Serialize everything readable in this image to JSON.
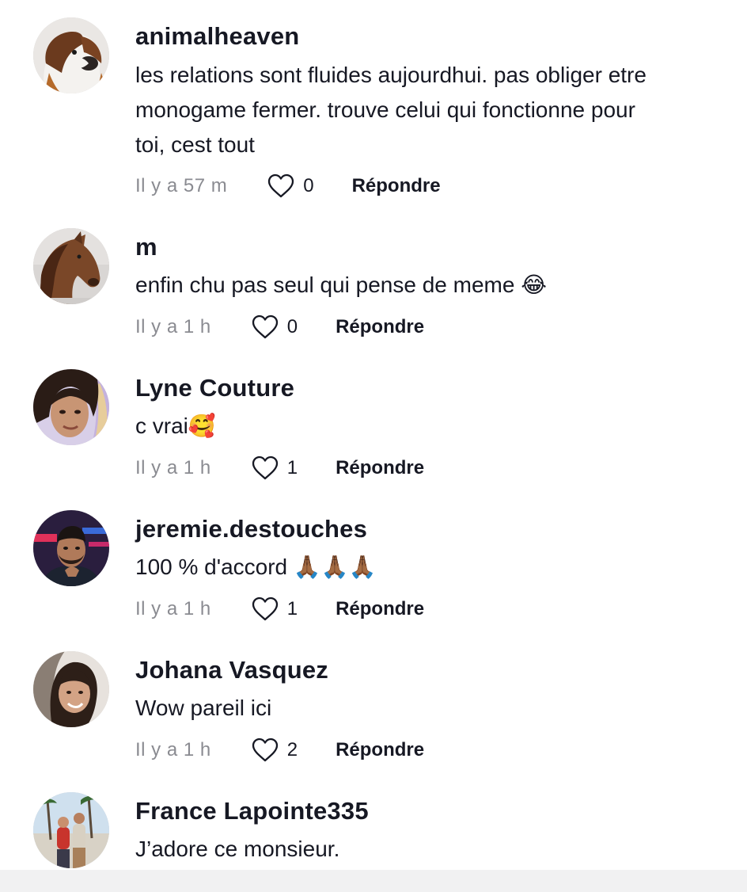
{
  "comments": [
    {
      "username": "animalheaven",
      "lines": [
        "les relations sont fluides aujourdhui. pas obliger etre",
        "monogame fermer. trouve celui qui fonctionne pour",
        "toi, cest tout"
      ],
      "time": "Il y a 57 m",
      "likes": "0",
      "reply": "Répondre",
      "avatar": "dog-photo"
    },
    {
      "username": "m",
      "lines": [
        "enfin chu pas seul qui pense de meme 😂"
      ],
      "time": "Il y a 1 h",
      "likes": "0",
      "reply": "Répondre",
      "avatar": "horse-photo"
    },
    {
      "username": "Lyne Couture",
      "lines": [
        "c vrai🥰"
      ],
      "time": "Il y a 1 h",
      "likes": "1",
      "reply": "Répondre",
      "avatar": "woman-photo"
    },
    {
      "username": "jeremie.destouches",
      "lines": [
        "100 % d'accord 🙏🏾🙏🏾🙏🏾"
      ],
      "time": "Il y a 1 h",
      "likes": "1",
      "reply": "Répondre",
      "avatar": "man-photo"
    },
    {
      "username": "Johana Vasquez",
      "lines": [
        "Wow pareil ici"
      ],
      "time": "Il y a 1 h",
      "likes": "2",
      "reply": "Répondre",
      "avatar": "woman-smiling-photo"
    },
    {
      "username": "France Lapointe335",
      "lines": [
        "J’adore ce monsieur."
      ],
      "avatar": "couple-beach-photo"
    }
  ],
  "colors": {
    "text": "#161823",
    "meta": "#8a8b91",
    "background": "#ffffff"
  },
  "icons": {
    "like": "heart-outline-icon"
  }
}
